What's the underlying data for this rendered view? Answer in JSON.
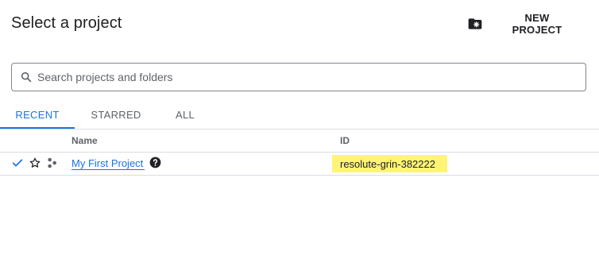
{
  "dialog": {
    "title": "Select a project",
    "new_project_label": "NEW PROJECT"
  },
  "search": {
    "placeholder": "Search projects and folders",
    "value": ""
  },
  "tabs": [
    {
      "label": "RECENT",
      "active": true
    },
    {
      "label": "STARRED",
      "active": false
    },
    {
      "label": "ALL",
      "active": false
    }
  ],
  "table": {
    "columns": [
      "Name",
      "ID"
    ],
    "rows": [
      {
        "selected": true,
        "starred": false,
        "name": "My First Project",
        "id": "resolute-grin-382222"
      }
    ]
  },
  "colors": {
    "accent": "#1a73e8",
    "highlight": "#fff475",
    "text": "#202124",
    "muted": "#5f6368"
  }
}
